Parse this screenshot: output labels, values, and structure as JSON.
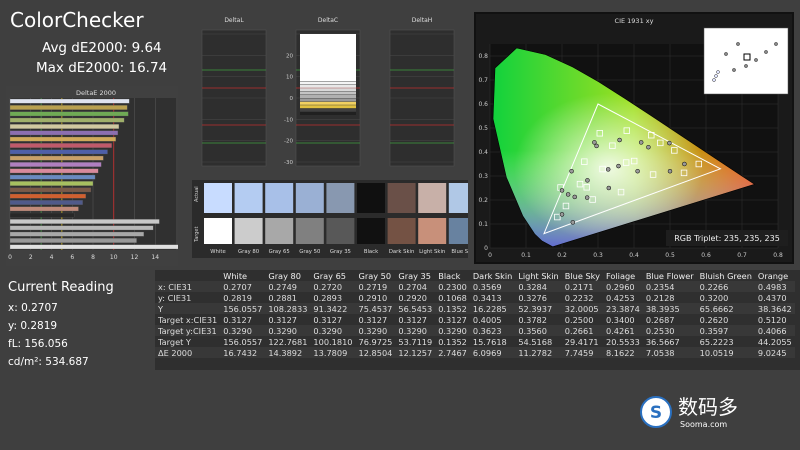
{
  "header": {
    "title": "ColorChecker",
    "avg": "Avg dE2000: 9.64",
    "max": "Max dE2000: 16.74"
  },
  "deltaE_chart": {
    "title": "DeltaE 2000",
    "ticks": [
      "0",
      "2",
      "4",
      "6",
      "8",
      "10",
      "12",
      "14"
    ],
    "values": [
      11.5,
      11.3,
      11.4,
      11.0,
      10.5,
      10.4,
      10.2,
      9.8,
      9.4,
      9.0,
      8.8,
      8.5,
      8.2,
      8.0,
      7.8,
      7.3,
      7.0,
      6.6,
      6.2,
      14.4,
      13.8,
      12.9,
      12.2,
      16.7
    ],
    "colors": [
      "#dfe3ef",
      "#b9a04f",
      "#6faa55",
      "#9faf6a",
      "#d0c8a0",
      "#8c6fb0",
      "#d0aa5a",
      "#c05a6a",
      "#4e5fa8",
      "#c8a06a",
      "#b07fc0",
      "#d98a9c",
      "#6a8ac0",
      "#a7c060",
      "#7a5a48",
      "#d06030",
      "#505a8a",
      "#c08a7a",
      "#282828",
      "#c8c8c8",
      "#b8b8b8",
      "#a8a8a8",
      "#989898",
      "#e0e0e0"
    ]
  },
  "delta_panels": [
    {
      "title": "DeltaL",
      "ticks": [
        "",
        "",
        "",
        "",
        "",
        "",
        ""
      ]
    },
    {
      "title": "DeltaC",
      "ticks": [
        "",
        "20",
        "10",
        "0",
        "-10",
        "-20",
        "-30"
      ]
    },
    {
      "title": "DeltaH",
      "ticks": [
        "",
        "",
        "",
        "",
        "",
        "",
        ""
      ]
    }
  ],
  "swatches": {
    "side_labels": [
      "Actual",
      "Target"
    ],
    "labels": [
      "White",
      "Gray 80",
      "Gray 65",
      "Gray 50",
      "Gray 35",
      "Black",
      "Dark Skin",
      "Light Skin",
      "Blue Sky"
    ],
    "actual": [
      "#c8dcff",
      "#b4ccf2",
      "#a8c0e8",
      "#9ab0d4",
      "#8898b0",
      "#101010",
      "#6a5048",
      "#c8b0a8",
      "#b0c8e6"
    ],
    "target": [
      "#ffffff",
      "#cccccc",
      "#a8a8a8",
      "#808080",
      "#585858",
      "#111111",
      "#745244",
      "#c8907a",
      "#6882a0"
    ]
  },
  "cie": {
    "title": "CIE 1931 xy",
    "rgb_triplet": "RGB Triplet: 235, 235, 235",
    "x_ticks": [
      "0",
      "0.1",
      "0.2",
      "0.3",
      "0.4",
      "0.5",
      "0.6",
      "0.7",
      "0.8"
    ],
    "y_ticks": [
      "0.8",
      "0.7",
      "0.6",
      "0.5",
      "0.4",
      "0.3",
      "0.2",
      "0.1",
      "0"
    ]
  },
  "current": {
    "title": "Current Reading",
    "x": "x: 0.2707",
    "y": "y: 0.2819",
    "fl": "fL: 156.056",
    "cdm2": "cd/m²: 534.687"
  },
  "table": {
    "columns": [
      "",
      "White",
      "Gray 80",
      "Gray 65",
      "Gray 50",
      "Gray 35",
      "Black",
      "Dark Skin",
      "Light Skin",
      "Blue Sky",
      "Foliage",
      "Blue Flower",
      "Bluish Green",
      "Orange"
    ],
    "rows": [
      [
        "x: CIE31",
        "0.2707",
        "0.2749",
        "0.2720",
        "0.2719",
        "0.2704",
        "0.2300",
        "0.3569",
        "0.3284",
        "0.2171",
        "0.2960",
        "0.2354",
        "0.2266",
        "0.4983"
      ],
      [
        "y: CIE31",
        "0.2819",
        "0.2881",
        "0.2893",
        "0.2910",
        "0.2920",
        "0.1068",
        "0.3413",
        "0.3276",
        "0.2232",
        "0.4253",
        "0.2128",
        "0.3200",
        "0.4370"
      ],
      [
        "Y",
        "156.0557",
        "108.2833",
        "91.3422",
        "75.4537",
        "56.5453",
        "0.1352",
        "16.2285",
        "52.3937",
        "32.0005",
        "23.3874",
        "38.3935",
        "65.6662",
        "38.3642"
      ],
      [
        "Target x:CIE31",
        "0.3127",
        "0.3127",
        "0.3127",
        "0.3127",
        "0.3127",
        "0.3127",
        "0.4005",
        "0.3782",
        "0.2500",
        "0.3400",
        "0.2687",
        "0.2620",
        "0.5120"
      ],
      [
        "Target y:CIE31",
        "0.3290",
        "0.3290",
        "0.3290",
        "0.3290",
        "0.3290",
        "0.3290",
        "0.3623",
        "0.3560",
        "0.2661",
        "0.4261",
        "0.2530",
        "0.3597",
        "0.4066"
      ],
      [
        "Target Y",
        "156.0557",
        "122.7681",
        "100.1810",
        "76.9725",
        "53.7119",
        "0.1352",
        "15.7618",
        "54.5168",
        "29.4171",
        "20.5533",
        "36.5667",
        "65.2223",
        "44.2055"
      ],
      [
        "ΔE 2000",
        "16.7432",
        "14.3892",
        "13.7809",
        "12.8504",
        "12.1257",
        "2.7467",
        "6.0969",
        "11.2782",
        "7.7459",
        "8.1622",
        "7.0538",
        "10.0519",
        "9.0245"
      ]
    ]
  },
  "watermark": {
    "cn": "数码多",
    "site": "Sooma.com"
  },
  "colors": {
    "background": "#3f3f3f",
    "table_bg": "#2f2f2f"
  }
}
